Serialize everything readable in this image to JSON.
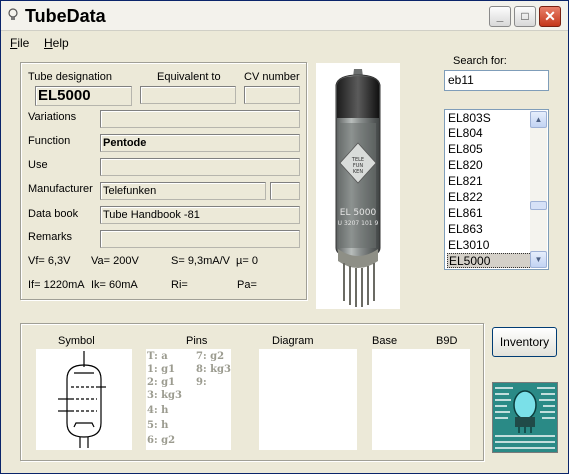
{
  "window": {
    "title": "TubeData",
    "minimize_glyph": "_",
    "maximize_glyph": "□",
    "close_glyph": "✕"
  },
  "menu": {
    "file": {
      "accel": "F",
      "rest": "ile"
    },
    "help": {
      "accel": "H",
      "rest": "elp"
    }
  },
  "tube": {
    "headers": {
      "designation": "Tube designation",
      "equivalent": "Equivalent to",
      "cv": "CV number"
    },
    "designation": "EL5000",
    "equivalent": "",
    "cv_number": "",
    "labels": {
      "variations": "Variations",
      "function": "Function",
      "use": "Use",
      "manufacturer": "Manufacturer",
      "data_book": "Data book",
      "remarks": "Remarks"
    },
    "variations": "",
    "function": "Pentode",
    "use": "",
    "manufacturer": "Telefunken",
    "manufacturer_extra": "",
    "data_book": "Tube Handbook -81",
    "remarks": "",
    "params": {
      "vf": "Vf= 6,3V",
      "va": "Va= 200V",
      "s": "S= 9,3mA/V",
      "mu": "µ=   0",
      "if": "If= 1220mA",
      "ik": "Ik=  60mA",
      "ri": "Ri=",
      "pa": "Pa="
    }
  },
  "photo": {
    "glass_print": [
      "EL 5000",
      "U 3207 101 9"
    ],
    "logo": "TELEFUNKEN"
  },
  "search": {
    "label": "Search for:",
    "value": "eb11",
    "results": [
      "EL803S",
      "EL804",
      "EL805",
      "EL820",
      "EL821",
      "EL822",
      "EL861",
      "EL863",
      "EL3010",
      "EL5000"
    ],
    "selected": "EL5000"
  },
  "bottom": {
    "symbol_header": "Symbol",
    "pins_header": "Pins",
    "diagram_header": "Diagram",
    "base_header": "Base",
    "base_code": "B9D",
    "pins_col1": [
      "T: a",
      "1: g1",
      "2: g1",
      "3: kg3",
      "4: h",
      "5: h",
      "6: g2"
    ],
    "pins_col2": [
      "7: g2",
      "8: kg3",
      "9:"
    ]
  },
  "inventory_button": "Inventory",
  "colors": {
    "window_bg": "#ece9d8",
    "selection_bg": "#d4d0c8",
    "close_button": "#c4361a",
    "pin_text": "#9b9b8f"
  }
}
